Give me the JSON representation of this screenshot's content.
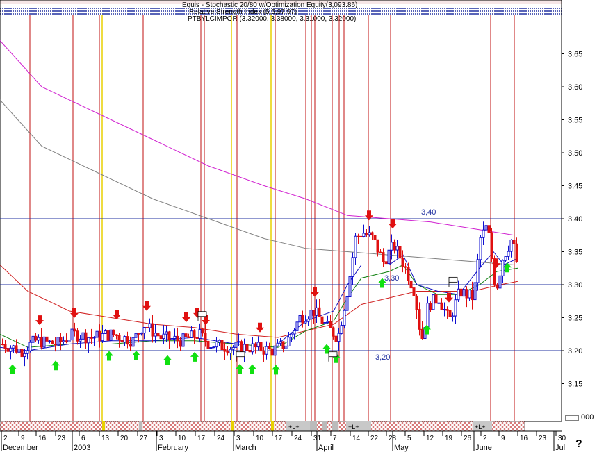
{
  "header": {
    "line1": "Equis - Stochastic 20/80 w/Optimization Equity(3,093.86)",
    "line2": "Relative Strength Index (5,5,97,97)",
    "line3": "PTBYLCIMPOR (3.32000, 3.38000, 3.31000, 3.32000)"
  },
  "colors": {
    "up_bar": "#1010d0",
    "down_bar": "#e01010",
    "ma_long": "#d020d0",
    "ma_mid": "#808080",
    "ma_short": "#d02020",
    "ma_fast_green": "#108010",
    "ma_fast_blue": "#1010c0",
    "level_line": "#2030a0",
    "red_vline": "#c01010",
    "yellow_vline": "#e8d000",
    "buy_arrow": "#10e010",
    "sell_arrow": "#e01010"
  },
  "icons": {
    "buy": "up-arrow-icon",
    "sell": "down-arrow-icon",
    "exit": "exit-flag-icon"
  },
  "bottom_strip": {
    "labels": [
      "+L+",
      "+L+",
      "+L+"
    ],
    "value_label": "000"
  },
  "corner_label": "?",
  "chart_data": {
    "type": "candlestick",
    "ylim": [
      3.1,
      3.7
    ],
    "yticks": [
      "3.15",
      "3.20",
      "3.25",
      "3.30",
      "3.35",
      "3.40",
      "3.45",
      "3.50",
      "3.55",
      "3.60",
      "3.65"
    ],
    "level_lines": [
      {
        "value": 3.4,
        "label": "3,40"
      },
      {
        "value": 3.3,
        "label": "3,30"
      },
      {
        "value": 3.2,
        "label": "3,20"
      }
    ],
    "xticks": [
      "2",
      "9",
      "16",
      "23",
      "6",
      "13",
      "20",
      "27",
      "3",
      "10",
      "17",
      "24",
      "3",
      "10",
      "17",
      "24",
      "31",
      "7",
      "14",
      "22",
      "28",
      "5",
      "12",
      "19",
      "26",
      "2",
      "9",
      "16",
      "23",
      "30"
    ],
    "months": [
      "December",
      "2003",
      "February",
      "March",
      "April",
      "May",
      "June",
      "Jul"
    ],
    "moving_averages": [
      {
        "name": "ma_long",
        "color": "#d020d0",
        "points": [
          [
            0,
            3.67
          ],
          [
            60,
            3.6
          ],
          [
            140,
            3.56
          ],
          [
            220,
            3.52
          ],
          [
            300,
            3.48
          ],
          [
            380,
            3.45
          ],
          [
            440,
            3.43
          ],
          [
            500,
            3.405
          ],
          [
            560,
            3.4
          ],
          [
            620,
            3.395
          ],
          [
            680,
            3.385
          ],
          [
            740,
            3.375
          ]
        ]
      },
      {
        "name": "ma_mid",
        "color": "#808080",
        "points": [
          [
            0,
            3.58
          ],
          [
            60,
            3.51
          ],
          [
            140,
            3.47
          ],
          [
            220,
            3.43
          ],
          [
            300,
            3.4
          ],
          [
            380,
            3.37
          ],
          [
            440,
            3.355
          ],
          [
            500,
            3.35
          ],
          [
            560,
            3.345
          ],
          [
            620,
            3.34
          ],
          [
            680,
            3.335
          ],
          [
            740,
            3.33
          ]
        ]
      },
      {
        "name": "ma_short",
        "color": "#d02020",
        "points": [
          [
            0,
            3.33
          ],
          [
            40,
            3.29
          ],
          [
            100,
            3.26
          ],
          [
            160,
            3.25
          ],
          [
            220,
            3.24
          ],
          [
            280,
            3.235
          ],
          [
            340,
            3.225
          ],
          [
            400,
            3.22
          ],
          [
            440,
            3.23
          ],
          [
            480,
            3.24
          ],
          [
            520,
            3.27
          ],
          [
            560,
            3.28
          ],
          [
            600,
            3.29
          ],
          [
            640,
            3.29
          ],
          [
            680,
            3.29
          ],
          [
            720,
            3.3
          ],
          [
            745,
            3.305
          ]
        ]
      },
      {
        "name": "ma_fast_green",
        "color": "#108010",
        "points": [
          [
            0,
            3.225
          ],
          [
            40,
            3.205
          ],
          [
            100,
            3.21
          ],
          [
            160,
            3.21
          ],
          [
            220,
            3.215
          ],
          [
            280,
            3.215
          ],
          [
            340,
            3.21
          ],
          [
            400,
            3.205
          ],
          [
            440,
            3.23
          ],
          [
            480,
            3.245
          ],
          [
            500,
            3.28
          ],
          [
            520,
            3.31
          ],
          [
            560,
            3.32
          ],
          [
            580,
            3.33
          ],
          [
            600,
            3.3
          ],
          [
            630,
            3.285
          ],
          [
            660,
            3.285
          ],
          [
            690,
            3.3
          ],
          [
            715,
            3.32
          ],
          [
            745,
            3.325
          ]
        ]
      },
      {
        "name": "ma_fast_blue",
        "color": "#1010c0",
        "points": [
          [
            0,
            3.205
          ],
          [
            40,
            3.2
          ],
          [
            100,
            3.21
          ],
          [
            160,
            3.215
          ],
          [
            220,
            3.215
          ],
          [
            280,
            3.22
          ],
          [
            340,
            3.21
          ],
          [
            400,
            3.21
          ],
          [
            440,
            3.245
          ],
          [
            480,
            3.26
          ],
          [
            500,
            3.3
          ],
          [
            520,
            3.33
          ],
          [
            560,
            3.33
          ],
          [
            580,
            3.345
          ],
          [
            600,
            3.3
          ],
          [
            630,
            3.29
          ],
          [
            660,
            3.285
          ],
          [
            690,
            3.325
          ],
          [
            710,
            3.35
          ],
          [
            725,
            3.33
          ],
          [
            745,
            3.34
          ]
        ]
      }
    ],
    "price_path": [
      [
        2,
        3.21
      ],
      [
        30,
        3.2
      ],
      [
        50,
        3.215
      ],
      [
        80,
        3.21
      ],
      [
        105,
        3.225
      ],
      [
        130,
        3.22
      ],
      [
        160,
        3.225
      ],
      [
        190,
        3.215
      ],
      [
        205,
        3.24
      ],
      [
        230,
        3.22
      ],
      [
        260,
        3.215
      ],
      [
        285,
        3.225
      ],
      [
        300,
        3.21
      ],
      [
        330,
        3.205
      ],
      [
        360,
        3.205
      ],
      [
        390,
        3.2
      ],
      [
        410,
        3.21
      ],
      [
        430,
        3.25
      ],
      [
        450,
        3.26
      ],
      [
        470,
        3.235
      ],
      [
        485,
        3.22
      ],
      [
        500,
        3.3
      ],
      [
        510,
        3.37
      ],
      [
        520,
        3.38
      ],
      [
        535,
        3.37
      ],
      [
        550,
        3.335
      ],
      [
        565,
        3.36
      ],
      [
        580,
        3.33
      ],
      [
        595,
        3.29
      ],
      [
        605,
        3.215
      ],
      [
        615,
        3.27
      ],
      [
        630,
        3.28
      ],
      [
        645,
        3.245
      ],
      [
        660,
        3.29
      ],
      [
        680,
        3.28
      ],
      [
        690,
        3.37
      ],
      [
        700,
        3.39
      ],
      [
        712,
        3.29
      ],
      [
        722,
        3.34
      ],
      [
        735,
        3.37
      ],
      [
        745,
        3.32
      ]
    ],
    "buy_signals_x": [
      18,
      80,
      157,
      196,
      241,
      280,
      345,
      363,
      397,
      470,
      484,
      550,
      614,
      730
    ],
    "sell_signals_x": [
      57,
      107,
      168,
      211,
      268,
      284,
      296,
      374,
      453,
      531,
      565,
      646,
      714
    ],
    "exit_flags": [
      [
        291,
        3.255
      ],
      [
        346,
        3.194
      ],
      [
        479,
        3.194
      ],
      [
        652,
        3.307
      ]
    ],
    "red_vlines_x": [
      43,
      105,
      143,
      206,
      289,
      294,
      341,
      396,
      440,
      448,
      453,
      478,
      488,
      495,
      530,
      562,
      706,
      740
    ],
    "yellow_vlines_x": [
      147,
      333,
      390
    ]
  }
}
